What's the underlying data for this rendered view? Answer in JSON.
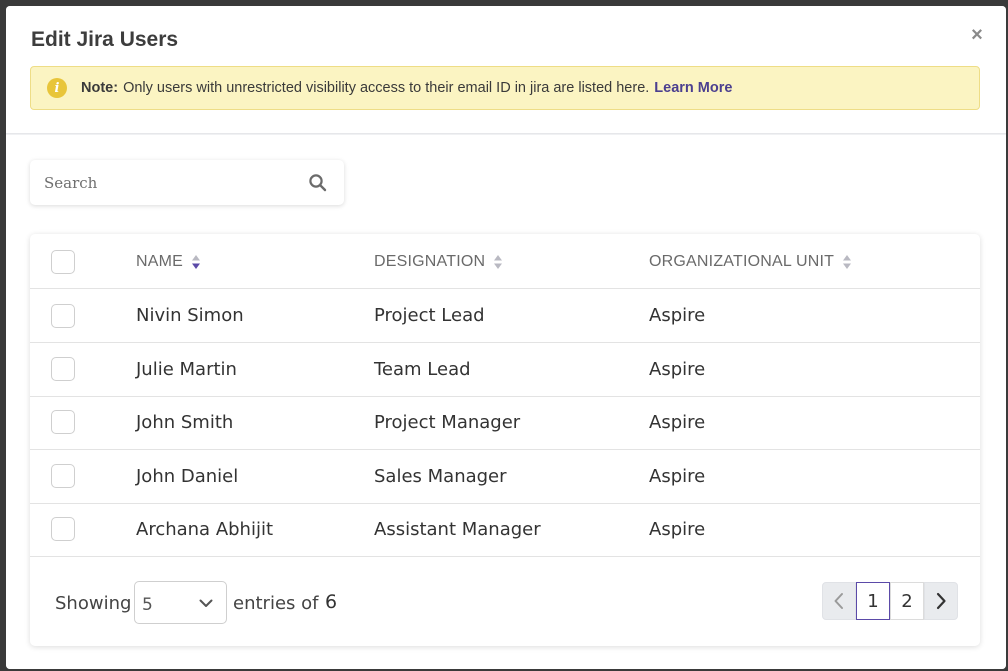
{
  "modal": {
    "title": "Edit Jira Users",
    "close_label": "×"
  },
  "note": {
    "label": "Note:",
    "text": "Only users with unrestricted visibility access to their email ID in jira are listed here.",
    "link": "Learn More"
  },
  "search": {
    "placeholder": "Search",
    "value": ""
  },
  "table": {
    "columns": [
      "NAME",
      "DESIGNATION",
      "ORGANIZATIONAL UNIT"
    ],
    "rows": [
      {
        "name": "Nivin Simon",
        "designation": "Project Lead",
        "org": "Aspire"
      },
      {
        "name": "Julie Martin",
        "designation": "Team Lead",
        "org": "Aspire"
      },
      {
        "name": "John Smith",
        "designation": "Project Manager",
        "org": "Aspire"
      },
      {
        "name": "John Daniel",
        "designation": "Sales Manager",
        "org": "Aspire"
      },
      {
        "name": "Archana Abhijit",
        "designation": "Assistant Manager",
        "org": "Aspire"
      }
    ]
  },
  "footer": {
    "showing_label": "Showing",
    "page_size": "5",
    "entries_label": "entries of",
    "total": "6"
  },
  "pagination": {
    "pages": [
      "1",
      "2"
    ],
    "current": "1"
  },
  "colors": {
    "accent": "#5b4aa8",
    "note_bg": "#fbf4c2",
    "note_icon": "#e8c53a"
  },
  "icons": {
    "note": "info-icon",
    "search": "search-icon",
    "close": "close-icon",
    "sort": "sort-icon",
    "select": "chevron-down-icon",
    "prev": "chevron-left-icon",
    "next": "chevron-right-icon"
  }
}
